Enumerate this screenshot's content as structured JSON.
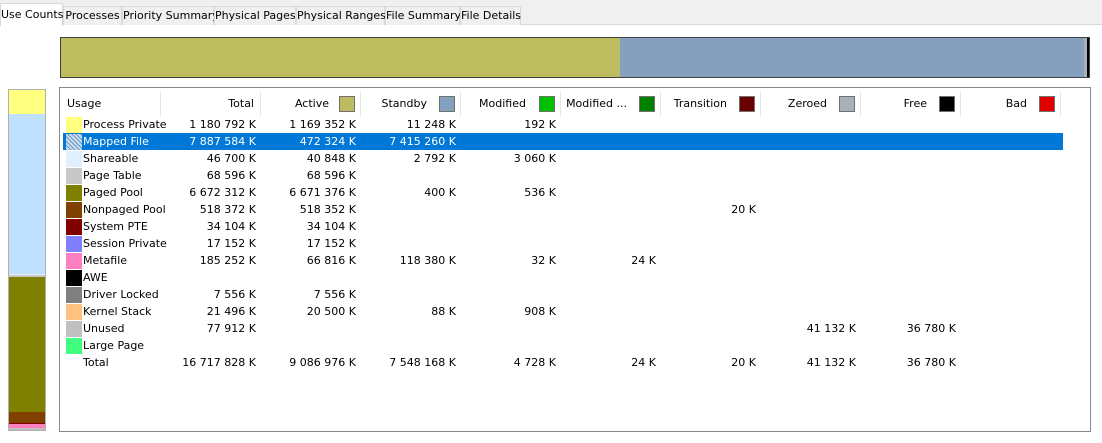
{
  "tabs": [
    {
      "label": "Use Counts",
      "active": true
    },
    {
      "label": "Processes",
      "active": false
    },
    {
      "label": "Priority Summary",
      "active": false
    },
    {
      "label": "Physical Pages",
      "active": false
    },
    {
      "label": "Physical Ranges",
      "active": false
    },
    {
      "label": "File Summary",
      "active": false
    },
    {
      "label": "File Details",
      "active": false
    }
  ],
  "columns": {
    "usage": "Usage",
    "total": "Total",
    "active": "Active",
    "standby": "Standby",
    "modified": "Modified",
    "modified_noWrite": "Modified ...",
    "transition": "Transition",
    "zeroed": "Zeroed",
    "free": "Free",
    "bad": "Bad"
  },
  "column_colors": {
    "active": "#bdbd60",
    "standby": "#859fbf",
    "modified": "#00c000",
    "modified_noWrite": "#008000",
    "transition": "#6b0000",
    "zeroed": "#a8b0b8",
    "free": "#000000",
    "bad": "#e00000"
  },
  "rows": [
    {
      "usage": "Process Private",
      "color": "#ffff80",
      "total": "1 180 792 K",
      "active": "1 169 352 K",
      "standby": "11 248 K",
      "modified": "192 K",
      "modified_noWrite": "",
      "transition": "",
      "zeroed": "",
      "free": "",
      "bad": ""
    },
    {
      "usage": "Mapped File",
      "color": "#c0e0ff",
      "hatched": true,
      "selected": true,
      "total": "7 887 584 K",
      "active": "472 324 K",
      "standby": "7 415 260 K",
      "modified": "",
      "modified_noWrite": "",
      "transition": "",
      "zeroed": "",
      "free": "",
      "bad": ""
    },
    {
      "usage": "Shareable",
      "color": "#e0f0ff",
      "total": "46 700 K",
      "active": "40 848 K",
      "standby": "2 792 K",
      "modified": "3 060 K",
      "modified_noWrite": "",
      "transition": "",
      "zeroed": "",
      "free": "",
      "bad": ""
    },
    {
      "usage": "Page Table",
      "color": "#c8c8c8",
      "total": "68 596 K",
      "active": "68 596 K",
      "standby": "",
      "modified": "",
      "modified_noWrite": "",
      "transition": "",
      "zeroed": "",
      "free": "",
      "bad": ""
    },
    {
      "usage": "Paged Pool",
      "color": "#808000",
      "total": "6 672 312 K",
      "active": "6 671 376 K",
      "standby": "400 K",
      "modified": "536 K",
      "modified_noWrite": "",
      "transition": "",
      "zeroed": "",
      "free": "",
      "bad": ""
    },
    {
      "usage": "Nonpaged Pool",
      "color": "#804000",
      "total": "518 372 K",
      "active": "518 352 K",
      "standby": "",
      "modified": "",
      "modified_noWrite": "",
      "transition": "20 K",
      "zeroed": "",
      "free": "",
      "bad": ""
    },
    {
      "usage": "System PTE",
      "color": "#800000",
      "total": "34 104 K",
      "active": "34 104 K",
      "standby": "",
      "modified": "",
      "modified_noWrite": "",
      "transition": "",
      "zeroed": "",
      "free": "",
      "bad": ""
    },
    {
      "usage": "Session Private",
      "color": "#8080ff",
      "total": "17 152 K",
      "active": "17 152 K",
      "standby": "",
      "modified": "",
      "modified_noWrite": "",
      "transition": "",
      "zeroed": "",
      "free": "",
      "bad": ""
    },
    {
      "usage": "Metafile",
      "color": "#ff80c0",
      "total": "185 252 K",
      "active": "66 816 K",
      "standby": "118 380 K",
      "modified": "32 K",
      "modified_noWrite": "24 K",
      "transition": "",
      "zeroed": "",
      "free": "",
      "bad": ""
    },
    {
      "usage": "AWE",
      "color": "#000000",
      "total": "",
      "active": "",
      "standby": "",
      "modified": "",
      "modified_noWrite": "",
      "transition": "",
      "zeroed": "",
      "free": "",
      "bad": ""
    },
    {
      "usage": "Driver Locked",
      "color": "#808080",
      "total": "7 556 K",
      "active": "7 556 K",
      "standby": "",
      "modified": "",
      "modified_noWrite": "",
      "transition": "",
      "zeroed": "",
      "free": "",
      "bad": ""
    },
    {
      "usage": "Kernel Stack",
      "color": "#ffc080",
      "total": "21 496 K",
      "active": "20 500 K",
      "standby": "88 K",
      "modified": "908 K",
      "modified_noWrite": "",
      "transition": "",
      "zeroed": "",
      "free": "",
      "bad": ""
    },
    {
      "usage": "Unused",
      "color": "#c0c0c0",
      "total": "77 912 K",
      "active": "",
      "standby": "",
      "modified": "",
      "modified_noWrite": "",
      "transition": "",
      "zeroed": "41 132 K",
      "free": "36 780 K",
      "bad": ""
    },
    {
      "usage": "Large Page",
      "color": "#40ff80",
      "total": "",
      "active": "",
      "standby": "",
      "modified": "",
      "modified_noWrite": "",
      "transition": "",
      "zeroed": "",
      "free": "",
      "bad": ""
    },
    {
      "usage": "Total",
      "color": "",
      "total": "16 717 828 K",
      "active": "9 086 976 K",
      "standby": "7 548 168 K",
      "modified": "4 728 K",
      "modified_noWrite": "24 K",
      "transition": "20 K",
      "zeroed": "41 132 K",
      "free": "36 780 K",
      "bad": ""
    }
  ],
  "state_bar": [
    {
      "state": "active",
      "color": "#bdbd60",
      "fraction": 0.5436
    },
    {
      "state": "standby",
      "color": "#859fbf",
      "fraction": 0.4515
    },
    {
      "state": "modified",
      "color": "#00c000",
      "fraction": 0.0003
    },
    {
      "state": "zeroed",
      "color": "#a8b0b8",
      "fraction": 0.0025
    },
    {
      "state": "free",
      "color": "#000000",
      "fraction": 0.0022
    }
  ],
  "usage_bar": [
    {
      "usage": "Process Private",
      "color": "#ffff80",
      "fraction": 0.0706
    },
    {
      "usage": "Mapped File",
      "color": "#c0e0ff",
      "fraction": 0.4718
    },
    {
      "usage": "Shareable",
      "color": "#e0f0ff",
      "fraction": 0.0028
    },
    {
      "usage": "Page Table",
      "color": "#c8c8c8",
      "fraction": 0.0041
    },
    {
      "usage": "Paged Pool",
      "color": "#808000",
      "fraction": 0.3991
    },
    {
      "usage": "Nonpaged Pool",
      "color": "#804000",
      "fraction": 0.031
    },
    {
      "usage": "System PTE",
      "color": "#800000",
      "fraction": 0.002
    },
    {
      "usage": "Session Private",
      "color": "#8080ff",
      "fraction": 0.001
    },
    {
      "usage": "Metafile",
      "color": "#ff80c0",
      "fraction": 0.0111
    },
    {
      "usage": "Driver Locked",
      "color": "#808080",
      "fraction": 0.0005
    },
    {
      "usage": "Kernel Stack",
      "color": "#ffc080",
      "fraction": 0.0013
    },
    {
      "usage": "Unused",
      "color": "#c0c0c0",
      "fraction": 0.0047
    }
  ]
}
